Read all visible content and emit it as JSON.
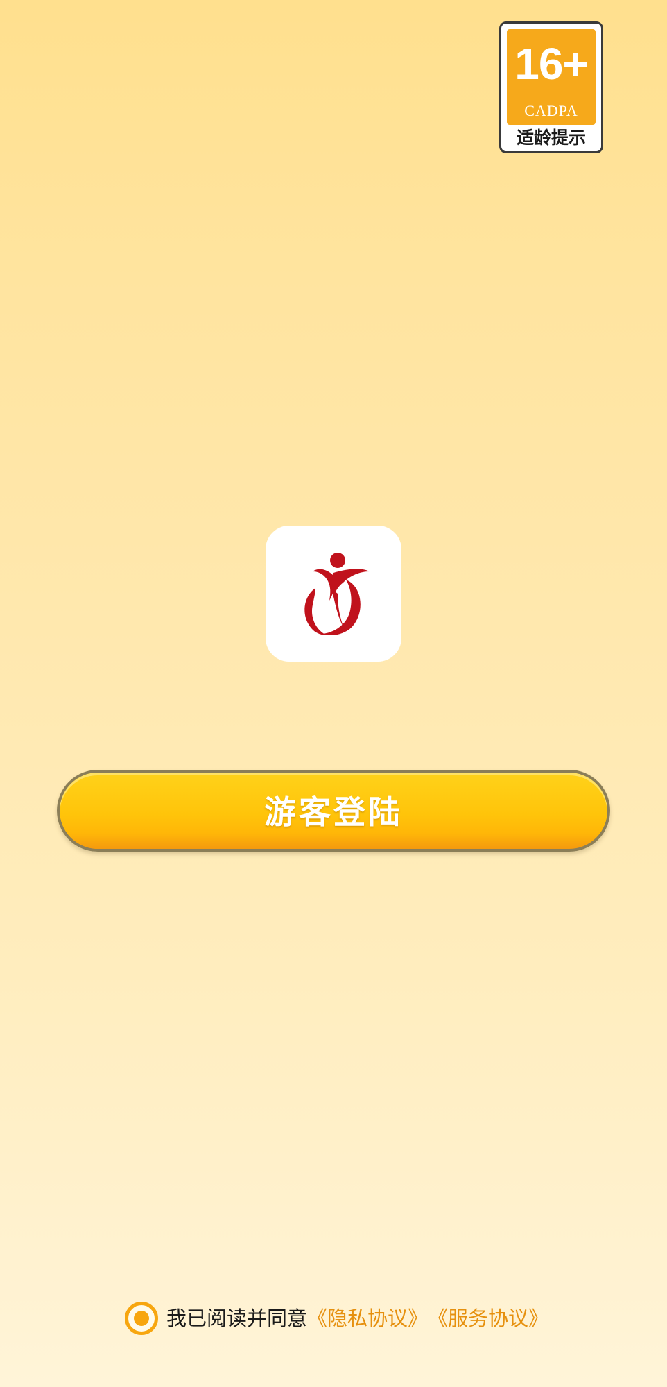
{
  "age_rating": {
    "age": "16+",
    "org": "CADPA",
    "note": "适龄提示"
  },
  "app_logo": {
    "icon": "app-logo-icon",
    "colors": {
      "tile": "#FFFFFF",
      "mark": "#C0121C"
    }
  },
  "login": {
    "guest_label": "游客登陆"
  },
  "agreement": {
    "checked": true,
    "prefix": "我已阅读并同意",
    "privacy_label": "《隐私协议》",
    "service_label": "《服务协议》"
  },
  "colors": {
    "accent": "#F7A60F",
    "link": "#E6900E",
    "button": "#FFC40A"
  }
}
